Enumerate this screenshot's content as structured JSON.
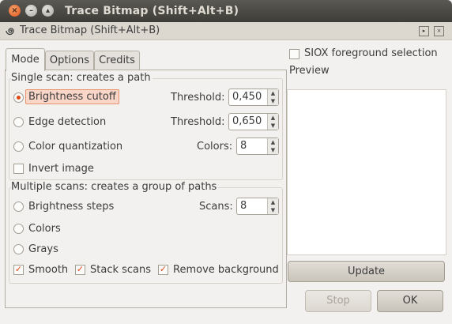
{
  "window": {
    "title": "Trace Bitmap (Shift+Alt+B)",
    "controls": {
      "close": "×",
      "minimize": "–",
      "maximize": "▴"
    }
  },
  "dock": {
    "title": "Trace Bitmap (Shift+Alt+B)",
    "icon": "spiral-trace-icon",
    "buttons": [
      "▸",
      "×"
    ]
  },
  "tabs": [
    {
      "label": "Mode",
      "active": true
    },
    {
      "label": "Options",
      "active": false
    },
    {
      "label": "Credits",
      "active": false
    }
  ],
  "single_scan": {
    "heading": "Single scan: creates a path",
    "brightness": {
      "label": "Brightness cutoff",
      "selected": true,
      "param_label": "Threshold:",
      "value": "0,450"
    },
    "edge": {
      "label": "Edge detection",
      "selected": false,
      "param_label": "Threshold:",
      "value": "0,650"
    },
    "color_quant": {
      "label": "Color quantization",
      "selected": false,
      "param_label": "Colors:",
      "value": "8"
    },
    "invert": {
      "label": "Invert image",
      "checked": false
    }
  },
  "multiple_scans": {
    "heading": "Multiple scans: creates a group of paths",
    "brightness_steps": {
      "label": "Brightness steps",
      "selected": false,
      "param_label": "Scans:",
      "value": "8"
    },
    "colors": {
      "label": "Colors",
      "selected": false
    },
    "grays": {
      "label": "Grays",
      "selected": false
    },
    "smooth": {
      "label": "Smooth",
      "checked": true
    },
    "stack": {
      "label": "Stack scans",
      "checked": true
    },
    "remove_bg": {
      "label": "Remove background",
      "checked": true
    }
  },
  "siox": {
    "label": "SIOX foreground selection",
    "checked": false
  },
  "preview": {
    "heading": "Preview",
    "update_label": "Update"
  },
  "actions": {
    "stop_label": "Stop",
    "ok_label": "OK"
  },
  "spin_arrows": {
    "up": "▲",
    "down": "▼"
  },
  "check_mark": "✓",
  "colors": {
    "accent": "#dd4814",
    "titlebar": "#3d3c38",
    "background": "#f2f1f0"
  }
}
